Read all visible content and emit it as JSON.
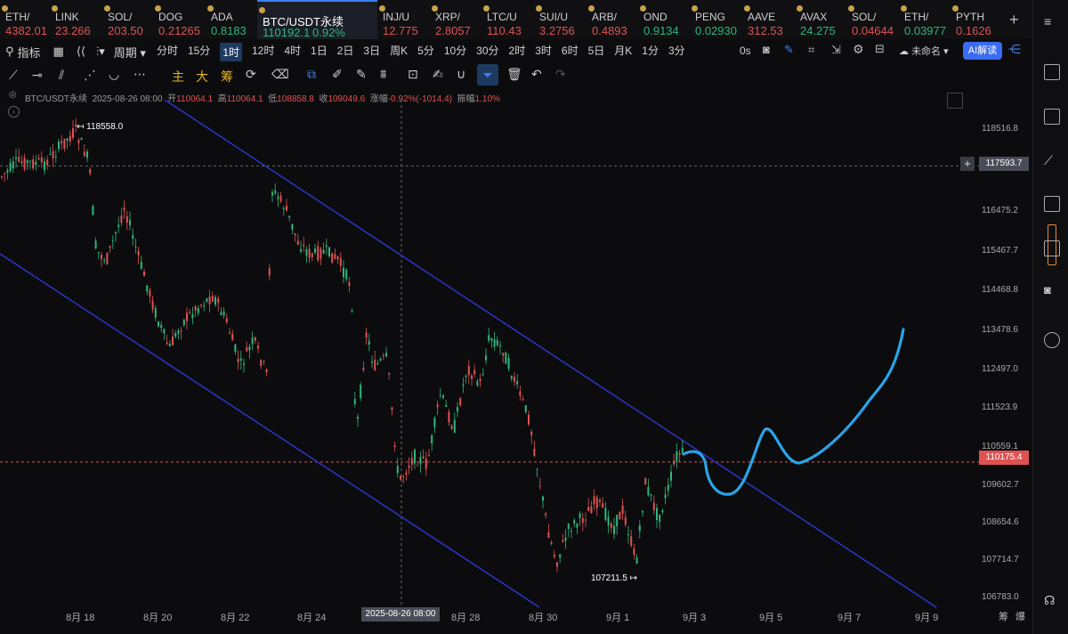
{
  "tickers": [
    {
      "symbol": "ETH/",
      "price": "4382.01",
      "dir": "down"
    },
    {
      "symbol": "LINK",
      "price": "23.266",
      "dir": "down"
    },
    {
      "symbol": "SOL/",
      "price": "203.50",
      "dir": "down"
    },
    {
      "symbol": "DOG",
      "price": "0.21265",
      "dir": "down"
    },
    {
      "symbol": "ADA",
      "price": "0.8183",
      "dir": "up"
    },
    {
      "symbol": "BTC/USDT永续",
      "price": "110192.1",
      "change": "0.92%",
      "dir": "up",
      "active": true
    },
    {
      "symbol": "INJ/U",
      "price": "12.775",
      "dir": "down"
    },
    {
      "symbol": "XRP/",
      "price": "2.8057",
      "dir": "down"
    },
    {
      "symbol": "LTC/U",
      "price": "110.43",
      "dir": "down"
    },
    {
      "symbol": "SUI/U",
      "price": "3.2756",
      "dir": "down"
    },
    {
      "symbol": "ARB/",
      "price": "0.4893",
      "dir": "down"
    },
    {
      "symbol": "OND",
      "price": "0.9134",
      "dir": "up"
    },
    {
      "symbol": "PENG",
      "price": "0.02930",
      "dir": "up"
    },
    {
      "symbol": "AAVE",
      "price": "312.53",
      "dir": "down"
    },
    {
      "symbol": "AVAX",
      "price": "24.275",
      "dir": "up"
    },
    {
      "symbol": "SOL/",
      "price": "0.04644",
      "dir": "down"
    },
    {
      "symbol": "ETH/",
      "price": "0.03977",
      "dir": "up"
    },
    {
      "symbol": "PYTH",
      "price": "0.1626",
      "dir": "down"
    }
  ],
  "toolbar": {
    "indicators": "指标",
    "period": "周期",
    "timeframes": [
      "分时",
      "15分",
      "1时",
      "12时",
      "4时",
      "1日",
      "2日",
      "3日",
      "周K",
      "5分",
      "10分",
      "30分",
      "2时",
      "3时",
      "6时",
      "5日",
      "月K",
      "1分",
      "3分"
    ],
    "active_timeframe": "1时",
    "countdown": "0s",
    "unnamed": "未命名",
    "ai_button": "AI解读"
  },
  "draw_tools": {
    "main": "主",
    "big": "大",
    "chip": "筹"
  },
  "ohlc": {
    "symbol": "BTC/USDT永续",
    "time": "2025-08-26 08:00",
    "open_label": "开",
    "open": "110064.1",
    "high_label": "高",
    "high": "110064.1",
    "low_label": "低",
    "low": "108858.8",
    "close_label": "收",
    "close": "109049.6",
    "change_label": "涨幅",
    "change": "-0.92%(-1014.4)",
    "amp_label": "振幅",
    "amp": "1.10%"
  },
  "chart_data": {
    "type": "candlestick",
    "y_axis_ticks": [
      "118516.8",
      "116475.2",
      "115467.7",
      "114468.8",
      "113478.6",
      "112497.0",
      "111523.9",
      "110559.1",
      "109602.7",
      "108654.6",
      "107714.7",
      "106783.0"
    ],
    "x_axis_ticks": [
      "8月 18",
      "8月 20",
      "8月 22",
      "8月 24",
      "2025-08-26 08:00",
      "8月 28",
      "8月 30",
      "9月 1",
      "9月 3",
      "9月 5",
      "9月 7",
      "9月 9"
    ],
    "high_annotation": "118558.0",
    "low_annotation": "107211.5",
    "crosshair_price": "117593.7",
    "last_price": "110175.4",
    "ylim": [
      106783.0,
      118516.8
    ]
  },
  "bottom_right": {
    "chip": "筹",
    "burst": "爆"
  },
  "colors": {
    "up": "#2fb67c",
    "down": "#e05252",
    "channel": "#2b35c8",
    "projection": "#2aa4e8",
    "accent": "#3b82f6"
  }
}
